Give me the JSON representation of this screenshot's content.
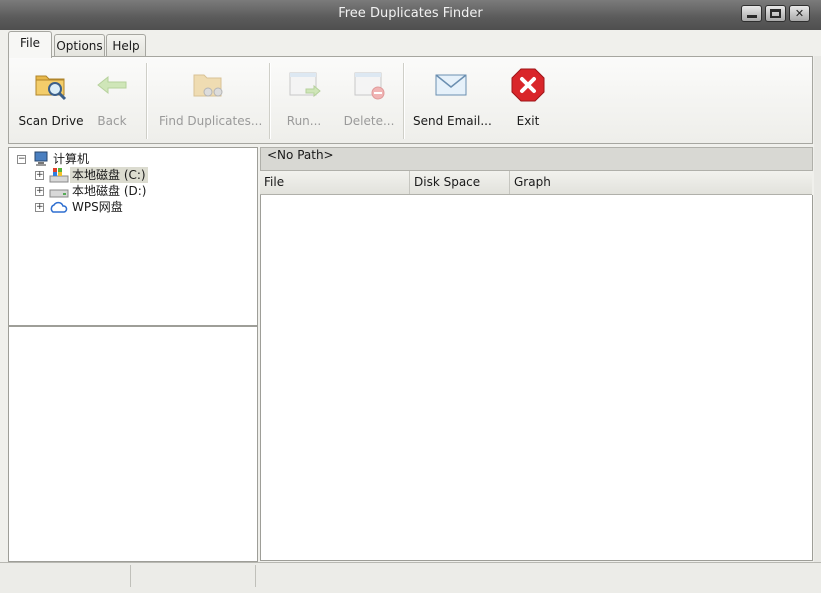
{
  "window": {
    "title": "Free Duplicates Finder"
  },
  "title_buttons": {
    "close": "✕"
  },
  "tabs": [
    {
      "label": "File",
      "active": true
    },
    {
      "label": "Options",
      "active": false
    },
    {
      "label": "Help",
      "active": false
    }
  ],
  "ribbon": {
    "scan_drive": "Scan Drive",
    "back": "Back",
    "find_duplicates": "Find Duplicates...",
    "run": "Run...",
    "delete": "Delete...",
    "send_email": "Send Email...",
    "exit": "Exit"
  },
  "tree": {
    "root": "计算机",
    "items": [
      {
        "label": "本地磁盘 (C:)",
        "selected": true
      },
      {
        "label": "本地磁盘 (D:)",
        "selected": false
      },
      {
        "label": "WPS网盘",
        "selected": false
      }
    ]
  },
  "main": {
    "path": "<No Path>",
    "columns": [
      "File",
      "Disk Space",
      "Graph"
    ]
  },
  "colors": {
    "exit_red": "#d9262a",
    "accent_folder": "#e8b84a"
  }
}
